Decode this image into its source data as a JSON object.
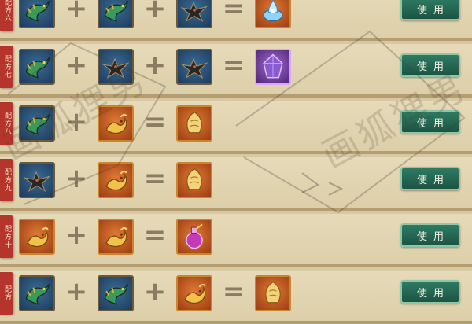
{
  "recipes": [
    {
      "tag": "配方六",
      "button": "使用",
      "slots": [
        {
          "frame": "blue",
          "icon": "green-dragon-icon"
        },
        {
          "op": "+"
        },
        {
          "frame": "blue",
          "icon": "green-dragon-icon"
        },
        {
          "op": "+"
        },
        {
          "frame": "blue",
          "icon": "black-dragon-icon"
        },
        {
          "op": "="
        },
        {
          "frame": "orange",
          "icon": "blue-flame-orb-icon"
        }
      ]
    },
    {
      "tag": "配方七",
      "button": "使用",
      "slots": [
        {
          "frame": "blue",
          "icon": "green-dragon-icon"
        },
        {
          "op": "+"
        },
        {
          "frame": "blue",
          "icon": "black-dragon-icon"
        },
        {
          "op": "+"
        },
        {
          "frame": "blue",
          "icon": "black-dragon-icon"
        },
        {
          "op": "="
        },
        {
          "frame": "purple",
          "icon": "purple-crystal-icon"
        }
      ]
    },
    {
      "tag": "配方八",
      "button": "使用",
      "slots": [
        {
          "frame": "blue",
          "icon": "green-dragon-icon"
        },
        {
          "op": "+"
        },
        {
          "frame": "orange",
          "icon": "golden-dragon-icon"
        },
        {
          "op": "="
        },
        {
          "frame": "orange",
          "icon": "golden-scale-icon"
        }
      ]
    },
    {
      "tag": "配方九",
      "button": "使用",
      "slots": [
        {
          "frame": "blue",
          "icon": "black-dragon-icon"
        },
        {
          "op": "+"
        },
        {
          "frame": "orange",
          "icon": "golden-dragon-icon"
        },
        {
          "op": "="
        },
        {
          "frame": "orange",
          "icon": "golden-scale-icon"
        }
      ]
    },
    {
      "tag": "配方十",
      "button": "使用",
      "slots": [
        {
          "frame": "orange",
          "icon": "golden-dragon-icon"
        },
        {
          "op": "+"
        },
        {
          "frame": "orange",
          "icon": "golden-dragon-icon"
        },
        {
          "op": "="
        },
        {
          "frame": "orange",
          "icon": "purple-potion-icon"
        }
      ]
    },
    {
      "tag": "配方",
      "button": "使用",
      "slots": [
        {
          "frame": "blue",
          "icon": "green-dragon-icon"
        },
        {
          "op": "+"
        },
        {
          "frame": "blue",
          "icon": "green-dragon-icon"
        },
        {
          "op": "+"
        },
        {
          "frame": "orange",
          "icon": "golden-dragon-icon"
        },
        {
          "op": "="
        },
        {
          "frame": "orange",
          "icon": "golden-scale-icon"
        }
      ]
    }
  ],
  "watermark": "画狐狸男"
}
